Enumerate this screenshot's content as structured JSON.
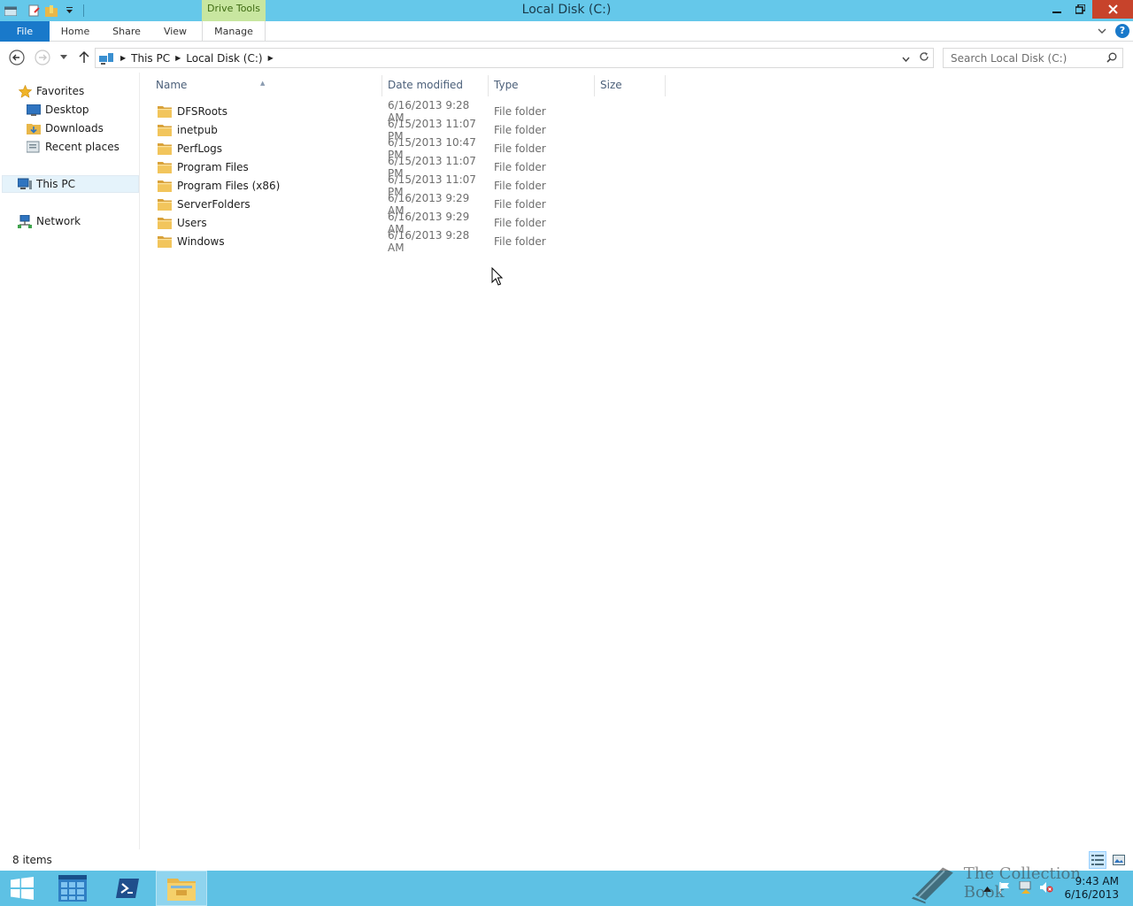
{
  "window": {
    "title": "Local Disk (C:)",
    "contextual_tab": "Drive Tools"
  },
  "ribbon": {
    "tabs": [
      {
        "label": "File"
      },
      {
        "label": "Home"
      },
      {
        "label": "Share"
      },
      {
        "label": "View"
      },
      {
        "label": "Manage"
      }
    ]
  },
  "address": {
    "breadcrumbs": [
      {
        "label": "This PC"
      },
      {
        "label": "Local Disk (C:)"
      }
    ]
  },
  "search": {
    "placeholder": "Search Local Disk (C:)"
  },
  "nav": {
    "favorites": "Favorites",
    "favorites_items": [
      {
        "label": "Desktop"
      },
      {
        "label": "Downloads"
      },
      {
        "label": "Recent places"
      }
    ],
    "this_pc": "This PC",
    "network": "Network"
  },
  "columns": {
    "name": "Name",
    "date": "Date modified",
    "type": "Type",
    "size": "Size"
  },
  "files": [
    {
      "name": "DFSRoots",
      "date": "6/16/2013 9:28 AM",
      "type": "File folder",
      "size": ""
    },
    {
      "name": "inetpub",
      "date": "6/15/2013 11:07 PM",
      "type": "File folder",
      "size": ""
    },
    {
      "name": "PerfLogs",
      "date": "6/15/2013 10:47 PM",
      "type": "File folder",
      "size": ""
    },
    {
      "name": "Program Files",
      "date": "6/15/2013 11:07 PM",
      "type": "File folder",
      "size": ""
    },
    {
      "name": "Program Files (x86)",
      "date": "6/15/2013 11:07 PM",
      "type": "File folder",
      "size": ""
    },
    {
      "name": "ServerFolders",
      "date": "6/16/2013 9:29 AM",
      "type": "File folder",
      "size": ""
    },
    {
      "name": "Users",
      "date": "6/16/2013 9:29 AM",
      "type": "File folder",
      "size": ""
    },
    {
      "name": "Windows",
      "date": "6/16/2013 9:28 AM",
      "type": "File folder",
      "size": ""
    }
  ],
  "status": {
    "items": "8 items"
  },
  "taskbar": {
    "time": "9:43 AM",
    "date": "6/16/2013"
  },
  "watermark": {
    "text": "The Collection Book"
  },
  "colors": {
    "titlebar": "#65c8ea",
    "file_tab": "#1979ca",
    "drive_tools": "#c8e6a0",
    "close_button": "#c7432b",
    "taskbar": "#5ec1e4",
    "folder": "#e8b74a"
  }
}
